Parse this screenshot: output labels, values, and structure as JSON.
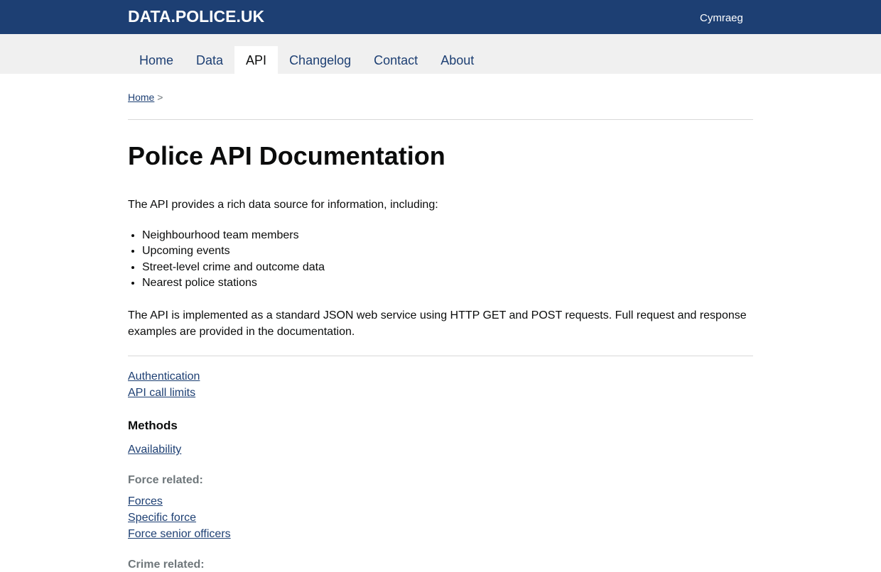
{
  "header": {
    "logo": "DATA.POLICE.UK",
    "language_link": "Cymraeg"
  },
  "nav": {
    "items": [
      {
        "label": "Home",
        "active": false
      },
      {
        "label": "Data",
        "active": false
      },
      {
        "label": "API",
        "active": true
      },
      {
        "label": "Changelog",
        "active": false
      },
      {
        "label": "Contact",
        "active": false
      },
      {
        "label": "About",
        "active": false
      }
    ]
  },
  "breadcrumb": {
    "home": "Home",
    "separator": ">"
  },
  "main": {
    "title": "Police API Documentation",
    "intro": "The API provides a rich data source for information, including:",
    "features": [
      "Neighbourhood team members",
      "Upcoming events",
      "Street-level crime and outcome data",
      "Nearest police stations"
    ],
    "description": "The API is implemented as a standard JSON web service using HTTP GET and POST requests. Full request and response examples are provided in the documentation.",
    "top_links": [
      "Authentication",
      "API call limits"
    ],
    "methods_heading": "Methods",
    "availability_link": "Availability",
    "force_heading": "Force related:",
    "force_links": [
      "Forces",
      "Specific force",
      "Force senior officers"
    ],
    "crime_heading": "Crime related:"
  },
  "colors": {
    "header_bg": "#1d3f73",
    "nav_bg": "#f0f0f0",
    "link": "#1d3f73",
    "muted": "#6f777b"
  }
}
